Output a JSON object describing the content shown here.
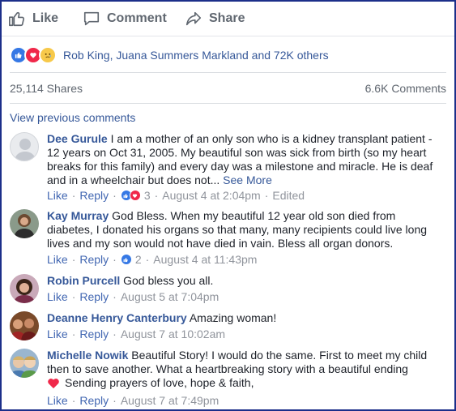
{
  "actions": {
    "like": "Like",
    "comment": "Comment",
    "share": "Share"
  },
  "reactions": {
    "text": "Rob King, Juana Summers Markland and 72K others"
  },
  "stats": {
    "shares": "25,114 Shares",
    "comments": "6.6K Comments"
  },
  "view_previous": "View previous comments",
  "comments": [
    {
      "name": "Dee Gurule",
      "text": "I am a mother of an only son who is a kidney transplant patient - 12 years on Oct 31, 2005. My beautiful son was sick from birth (so my heart breaks for this family) and every day was a milestone and miracle. He is deaf and in a wheelchair but does not...",
      "see_more": "See More",
      "like": "Like",
      "reply": "Reply",
      "reaction_count": "3",
      "time": "August 4 at 2:04pm",
      "edited": "Edited"
    },
    {
      "name": "Kay Murray",
      "text": "God Bless. When my beautiful 12 year old son died from diabetes, I donated his organs so that many, many recipients could live long lives and my son would not have died in vain. Bless all organ donors.",
      "like": "Like",
      "reply": "Reply",
      "reaction_count": "2",
      "time": "August 4 at 11:43pm"
    },
    {
      "name": "Robin Purcell",
      "text": "God bless you all.",
      "like": "Like",
      "reply": "Reply",
      "time": "August 5 at 7:04pm"
    },
    {
      "name": "Deanne Henry Canterbury",
      "text": "Amazing woman!",
      "like": "Like",
      "reply": "Reply",
      "time": "August 7 at 10:02am"
    },
    {
      "name": "Michelle Nowik",
      "text": "Beautiful Story! I would do the same. First to meet my child then to save another. What a heartbreaking story with a beautiful ending",
      "text2": "Sending prayers of love, hope & faith,",
      "like": "Like",
      "reply": "Reply",
      "time": "August 7 at 7:49pm"
    }
  ],
  "colors": {
    "link": "#365899",
    "meta": "#90949c",
    "like_blue": "#3578e5",
    "love_red": "#f0284a",
    "frame": "#1c2f8a"
  }
}
